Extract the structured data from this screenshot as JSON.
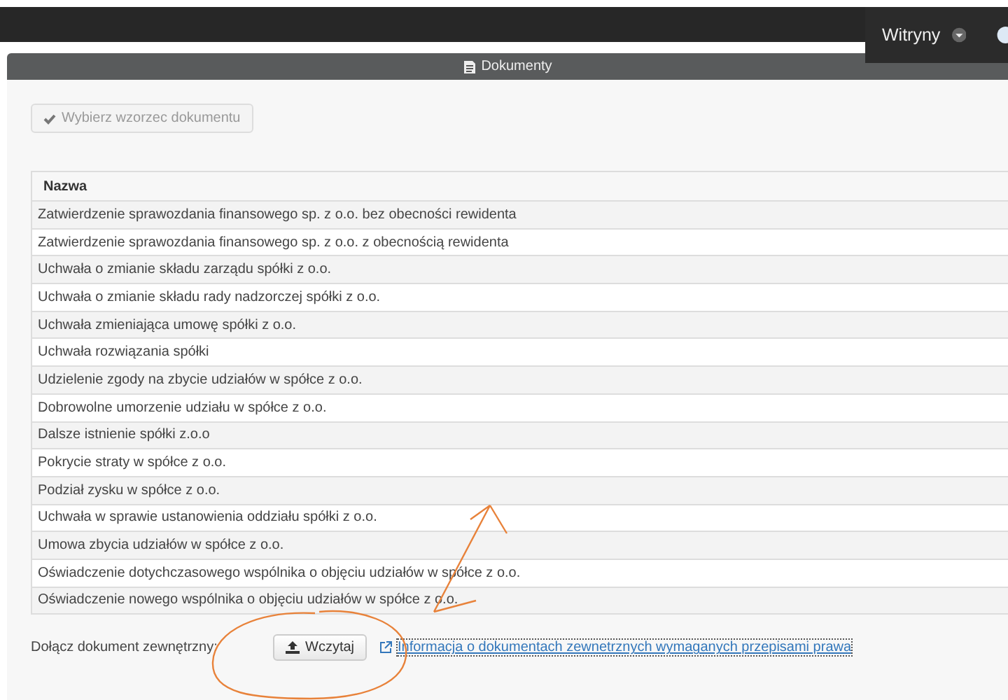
{
  "top_bar": {
    "sites_menu": {
      "label": "Witryny"
    }
  },
  "panel": {
    "title": "Dokumenty",
    "template_button": {
      "label": "Wybierz wzorzec dokumentu",
      "disabled": true
    },
    "table": {
      "columns": [
        "Nazwa"
      ],
      "rows": [
        "Zatwierdzenie sprawozdania finansowego sp. z o.o. bez obecności rewidenta",
        "Zatwierdzenie sprawozdania finansowego sp. z o.o. z obecnością rewidenta",
        "Uchwała o zmianie składu zarządu spółki z o.o.",
        "Uchwała o zmianie składu rady nadzorczej spółki z o.o.",
        "Uchwała zmieniająca umowę spółki z o.o.",
        "Uchwała rozwiązania spółki",
        "Udzielenie zgody na zbycie udziałów w spółce z o.o.",
        "Dobrowolne umorzenie udziału w spółce z o.o.",
        "Dalsze istnienie spółki z.o.o",
        "Pokrycie straty w spółce z o.o.",
        "Podział zysku w spółce z o.o.",
        "Uchwała w sprawie ustanowienia oddziału spółki z o.o.",
        "Umowa zbycia udziałów w spółce z o.o.",
        "Oświadczenie dotychczasowego wspólnika o objęciu udziałów w spółce z o.o.",
        "Oświadczenie nowego wspólnika o objęciu udziałów w spółce z o.o."
      ]
    },
    "attach": {
      "label": "Dołącz dokument zewnętrzny:",
      "upload_button": "Wczytaj",
      "info_link": "Informacja o dokumentach zewnetrznych wymaganych przepisami prawa"
    }
  }
}
